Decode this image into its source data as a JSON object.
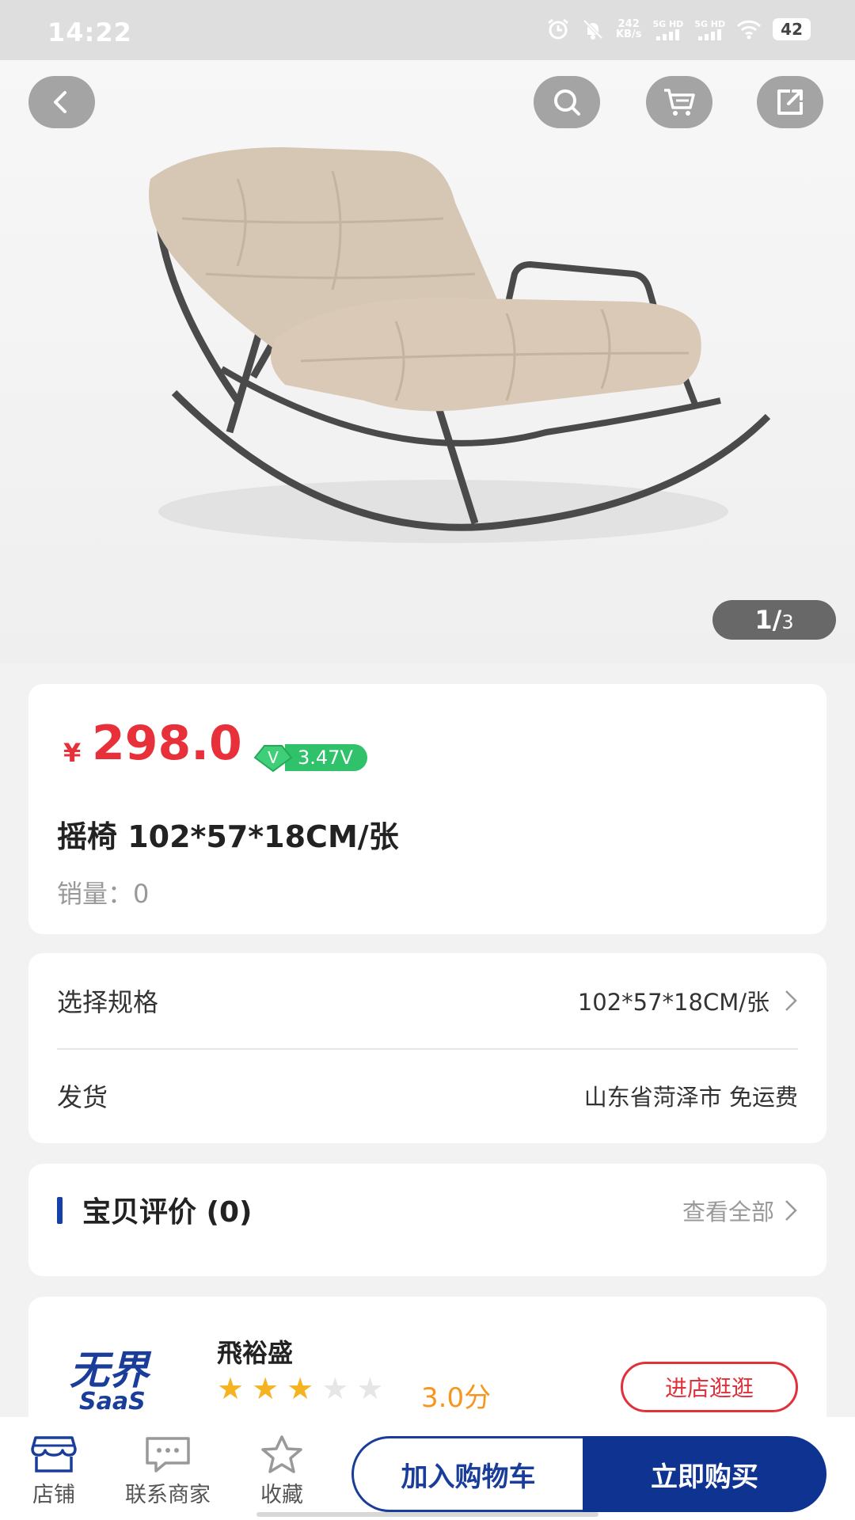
{
  "status_bar": {
    "time": "14:22",
    "net_speed": "242",
    "net_unit": "KB/s",
    "sim1": "5G HD",
    "sim2": "5G HD",
    "battery": "42",
    "icons": [
      "alarm-icon",
      "mute-bell-icon",
      "signal-icon",
      "wifi-icon",
      "battery-icon"
    ]
  },
  "hero": {
    "icons": [
      "back-arrow-icon",
      "search-icon",
      "cart-icon",
      "share-icon"
    ],
    "counter_current": "1/",
    "counter_total": "3"
  },
  "product": {
    "currency": "¥",
    "price": "298.0",
    "v_badge_letter": "V",
    "v_value": "3.47V",
    "title": "摇椅  102*57*18CM/张",
    "sales_label": "销量：",
    "sales_value": "0"
  },
  "spec": {
    "label": "选择规格",
    "value": "102*57*18CM/张",
    "shipping_label": "发货",
    "shipping_value": "山东省菏泽市  免运费"
  },
  "reviews": {
    "title": "宝贝评价 (0)",
    "view_all": "查看全部"
  },
  "shop": {
    "logo_text": "无界",
    "logo_sub": "SaaS",
    "name": "飛裕盛",
    "rating_value": 3,
    "rating_max": 5,
    "rating_text": "3.0分",
    "visit_label": "进店逛逛"
  },
  "bottom_bar": {
    "tabs": [
      {
        "label": "店铺",
        "icon": "store-icon"
      },
      {
        "label": "联系商家",
        "icon": "chat-icon"
      },
      {
        "label": "收藏",
        "icon": "star-outline-icon"
      }
    ],
    "add_to_cart": "加入购物车",
    "buy_now": "立即购买"
  },
  "colors": {
    "price_red": "#e8303a",
    "brand_blue": "#0f3391",
    "badge_green": "#2fc26a",
    "star_gold": "#f6b321"
  }
}
